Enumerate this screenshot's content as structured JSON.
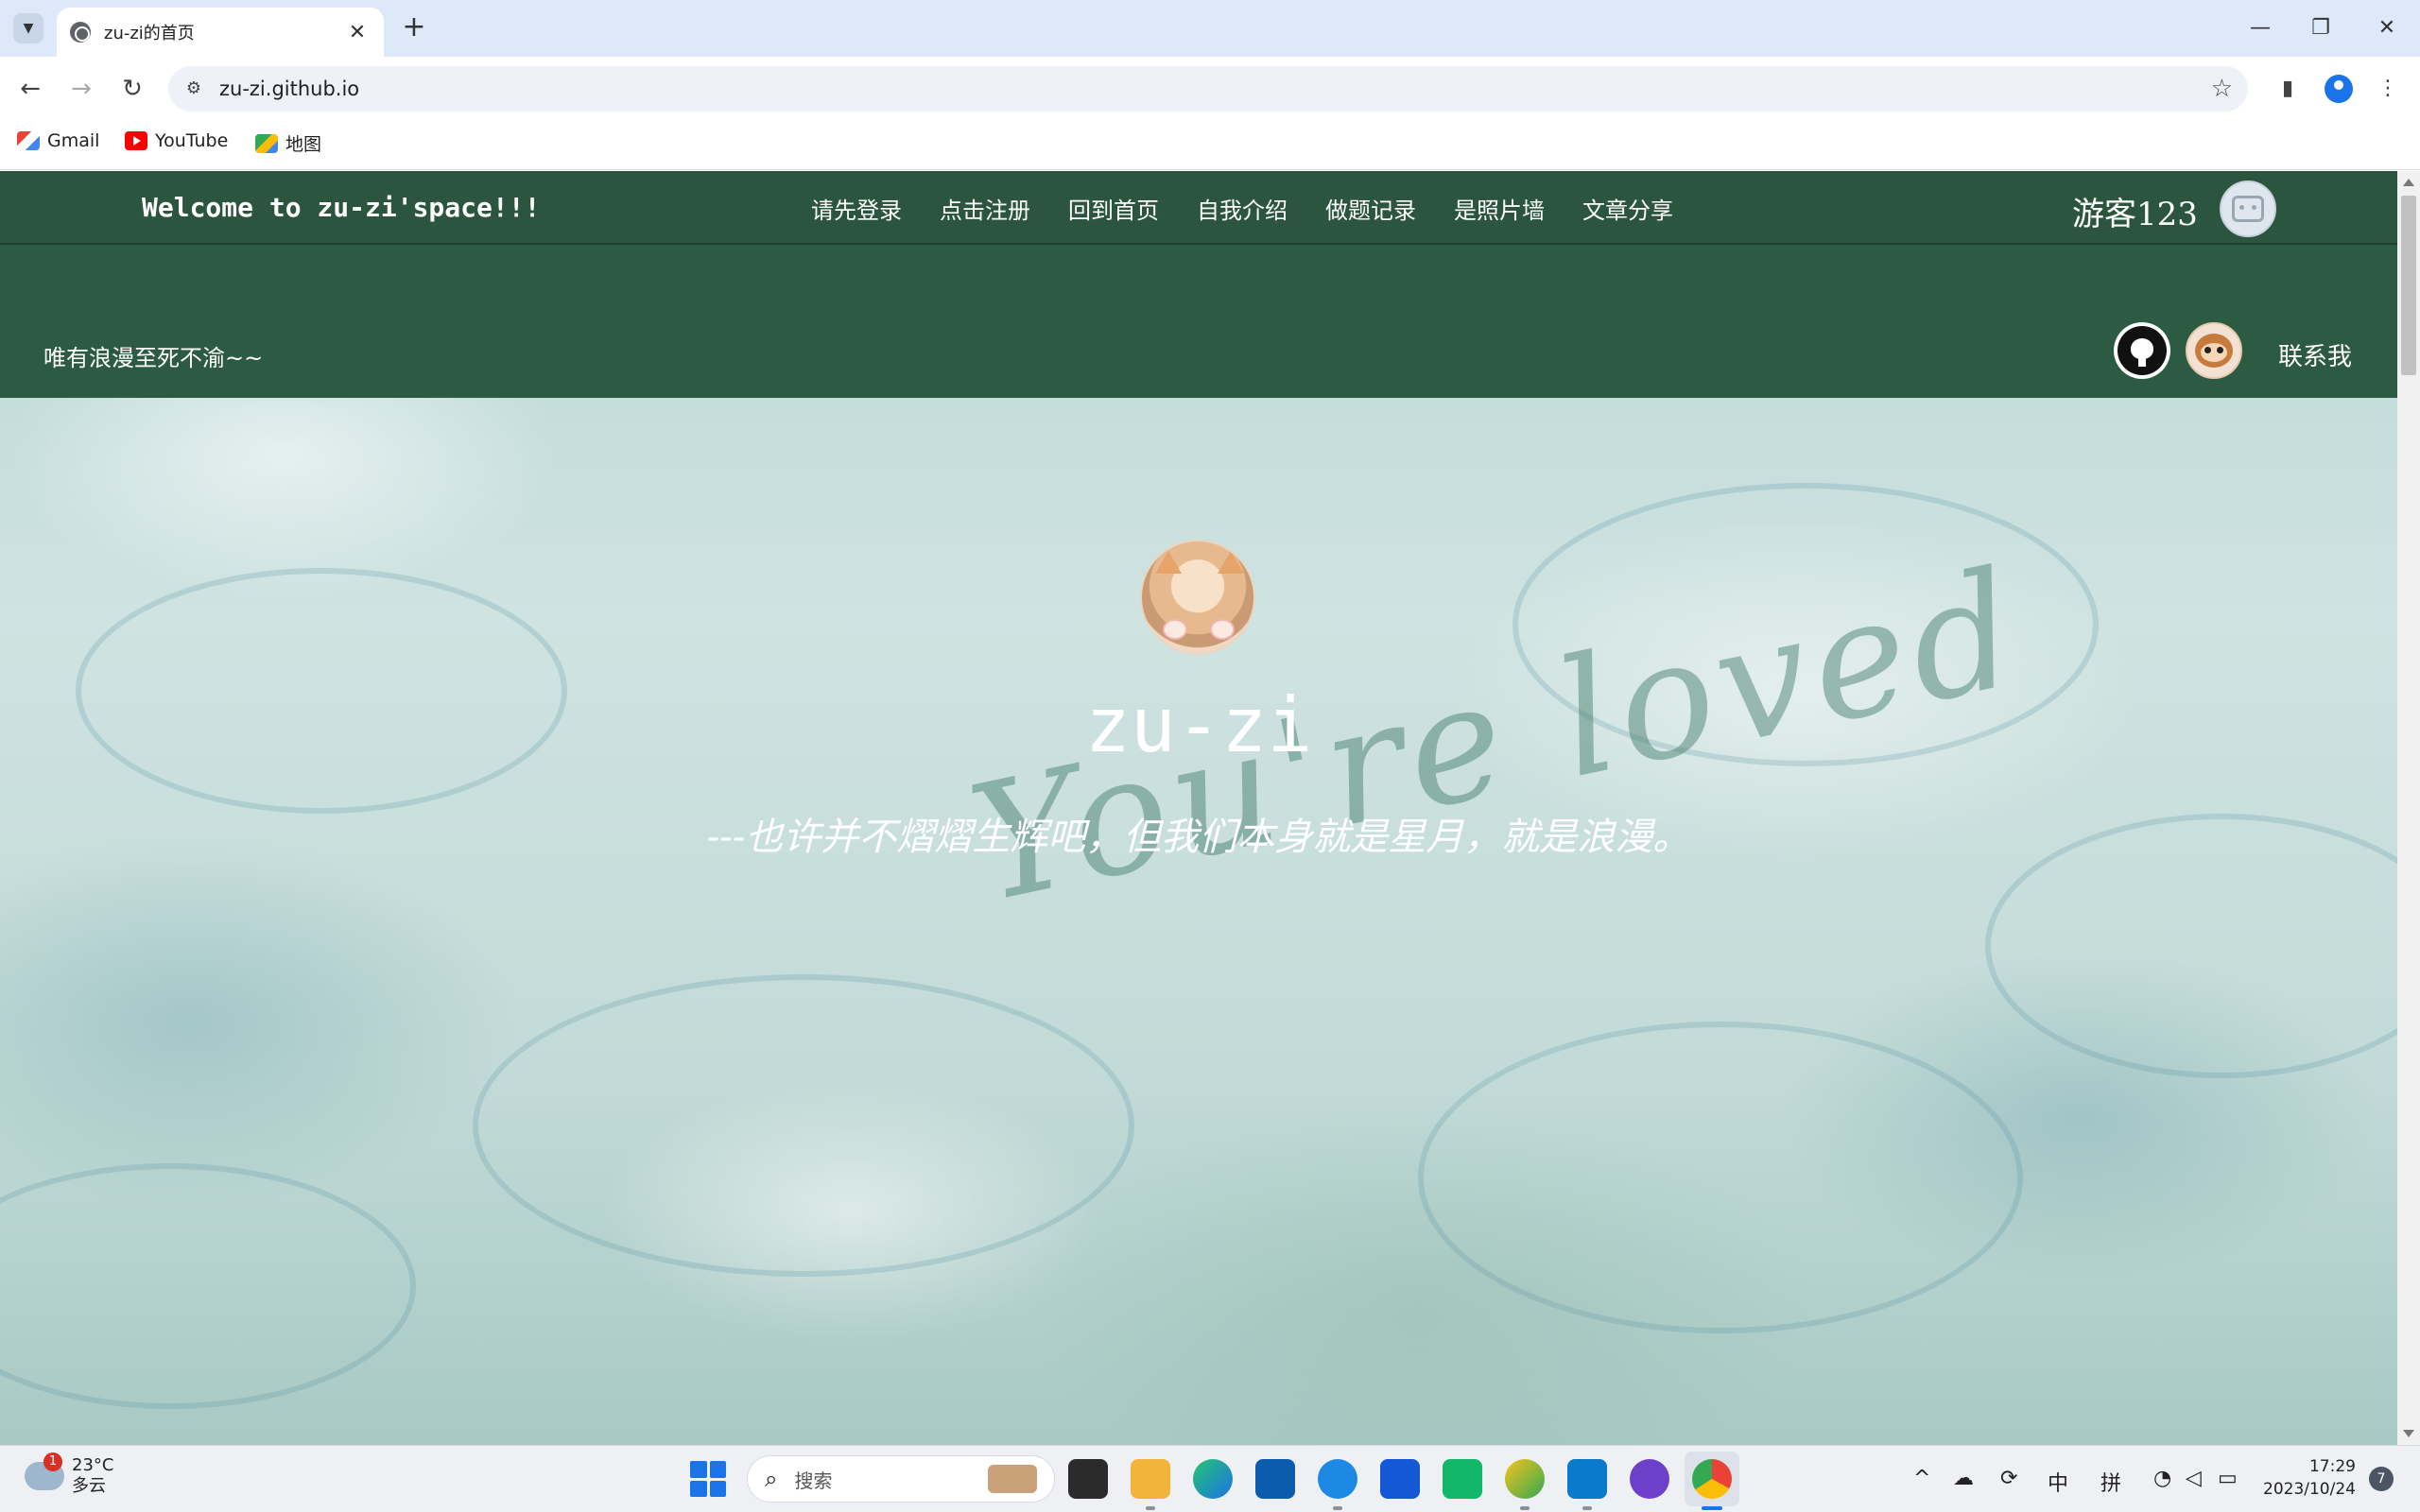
{
  "browser": {
    "tab_title": "zu-zi的首页",
    "tab_close": "✕",
    "new_tab": "+",
    "url": "zu-zi.github.io",
    "window_controls": {
      "minimize": "—",
      "restore": "❐",
      "close": "✕"
    },
    "bookmarks": [
      {
        "label": "Gmail",
        "icon": "gmail-icon"
      },
      {
        "label": "YouTube",
        "icon": "youtube-icon"
      },
      {
        "label": "地图",
        "icon": "maps-icon"
      }
    ]
  },
  "site": {
    "welcome": "Welcome to zu-zi'space!!!",
    "nav_links": [
      "请先登录",
      "点击注册",
      "回到首页",
      "自我介绍",
      "做题记录",
      "是照片墙",
      "文章分享"
    ],
    "guest_name": "游客123",
    "motto": "唯有浪漫至死不渝~~",
    "contact": "联系我",
    "hero_name": "zu-zi",
    "hero_quote": "---也许并不熠熠生辉吧，但我们本身就是星月，就是浪漫。",
    "watermark": "You're loved",
    "colors": {
      "nav_bg": "#2b553e",
      "subbar_bg": "#2d5a42",
      "text": "#ffffff"
    }
  },
  "taskbar": {
    "weather_temp": "23°C",
    "weather_desc": "多云",
    "weather_badge": "1",
    "search_placeholder": "搜索",
    "ime_lang": "中",
    "ime_mode": "拼",
    "time": "17:29",
    "date": "2023/10/24",
    "notifications": "7"
  }
}
